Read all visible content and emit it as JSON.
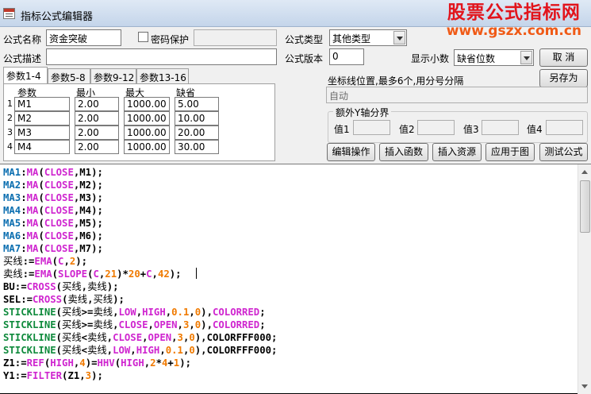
{
  "colors": {
    "keyword": "#0b6eb0",
    "function": "#cf25cf",
    "constant": "#f07a00",
    "text": "#000000",
    "watermark": "#e2141c"
  },
  "title": "指标公式编辑器",
  "watermark": {
    "line1": "股票公式指标网",
    "line2": "www.gszx.com.cn"
  },
  "form": {
    "name_label": "公式名称",
    "name_value": "资金突破",
    "password_label": "密码保护",
    "password_checked": false,
    "type_label": "公式类型",
    "type_value": "其他类型",
    "desc_label": "公式描述",
    "desc_value": "",
    "version_label": "公式版本",
    "version_value": "0",
    "decimal_label": "显示小数",
    "decimal_value": "缺省位数"
  },
  "buttons": {
    "cancel": "取  消",
    "save_as": "另存为",
    "edit_ops": "编辑操作",
    "insert_func": "插入函数",
    "insert_resource": "插入资源",
    "apply_chart": "应用于图",
    "test_formula": "测试公式"
  },
  "tabs": [
    {
      "label": "参数1-4",
      "active": true
    },
    {
      "label": "参数5-8",
      "active": false
    },
    {
      "label": "参数9-12",
      "active": false
    },
    {
      "label": "参数13-16",
      "active": false
    }
  ],
  "params": {
    "headers": [
      "参数",
      "最小",
      "最大",
      "缺省"
    ],
    "rows": [
      {
        "num": "1",
        "name": "M1",
        "min": "2.00",
        "max": "1000.00",
        "default": "5.00"
      },
      {
        "num": "2",
        "name": "M2",
        "min": "2.00",
        "max": "1000.00",
        "default": "10.00"
      },
      {
        "num": "3",
        "name": "M3",
        "min": "2.00",
        "max": "1000.00",
        "default": "20.00"
      },
      {
        "num": "4",
        "name": "M4",
        "min": "2.00",
        "max": "1000.00",
        "default": "30.00"
      }
    ]
  },
  "axis": {
    "label": "坐标线位置,最多6个,用分号分隔",
    "value": "自动",
    "group_title": "额外Y轴分界",
    "values": [
      {
        "label": "值1",
        "value": ""
      },
      {
        "label": "值2",
        "value": ""
      },
      {
        "label": "值3",
        "value": ""
      },
      {
        "label": "值4",
        "value": ""
      }
    ]
  },
  "code_lines": [
    [
      {
        "t": "MA1",
        "c": "k"
      },
      {
        "t": ":",
        "c": "n"
      },
      {
        "t": "MA",
        "c": "f"
      },
      {
        "t": "(",
        "c": "n"
      },
      {
        "t": "CLOSE",
        "c": "f"
      },
      {
        "t": ",M1);",
        "c": "n"
      }
    ],
    [
      {
        "t": "MA2",
        "c": "k"
      },
      {
        "t": ":",
        "c": "n"
      },
      {
        "t": "MA",
        "c": "f"
      },
      {
        "t": "(",
        "c": "n"
      },
      {
        "t": "CLOSE",
        "c": "f"
      },
      {
        "t": ",M2);",
        "c": "n"
      }
    ],
    [
      {
        "t": "MA3",
        "c": "k"
      },
      {
        "t": ":",
        "c": "n"
      },
      {
        "t": "MA",
        "c": "f"
      },
      {
        "t": "(",
        "c": "n"
      },
      {
        "t": "CLOSE",
        "c": "f"
      },
      {
        "t": ",M3);",
        "c": "n"
      }
    ],
    [
      {
        "t": "MA4",
        "c": "k"
      },
      {
        "t": ":",
        "c": "n"
      },
      {
        "t": "MA",
        "c": "f"
      },
      {
        "t": "(",
        "c": "n"
      },
      {
        "t": "CLOSE",
        "c": "f"
      },
      {
        "t": ",M4);",
        "c": "n"
      }
    ],
    [
      {
        "t": "MA5",
        "c": "k"
      },
      {
        "t": ":",
        "c": "n"
      },
      {
        "t": "MA",
        "c": "f"
      },
      {
        "t": "(",
        "c": "n"
      },
      {
        "t": "CLOSE",
        "c": "f"
      },
      {
        "t": ",M5);",
        "c": "n"
      }
    ],
    [
      {
        "t": "MA6",
        "c": "k"
      },
      {
        "t": ":",
        "c": "n"
      },
      {
        "t": "MA",
        "c": "f"
      },
      {
        "t": "(",
        "c": "n"
      },
      {
        "t": "CLOSE",
        "c": "f"
      },
      {
        "t": ",M6);",
        "c": "n"
      }
    ],
    [
      {
        "t": "MA7",
        "c": "k"
      },
      {
        "t": ":",
        "c": "n"
      },
      {
        "t": "MA",
        "c": "f"
      },
      {
        "t": "(",
        "c": "n"
      },
      {
        "t": "CLOSE",
        "c": "f"
      },
      {
        "t": ",M7);",
        "c": "n"
      }
    ],
    [
      {
        "t": "买线",
        "c": "cn"
      },
      {
        "t": ":=",
        "c": "n"
      },
      {
        "t": "EMA",
        "c": "f"
      },
      {
        "t": "(",
        "c": "n"
      },
      {
        "t": "C",
        "c": "f"
      },
      {
        "t": ",",
        "c": "n"
      },
      {
        "t": "2",
        "c": "o"
      },
      {
        "t": ");",
        "c": "n"
      }
    ],
    [
      {
        "t": "卖线",
        "c": "cn"
      },
      {
        "t": ":=",
        "c": "n"
      },
      {
        "t": "EMA",
        "c": "f"
      },
      {
        "t": "(",
        "c": "n"
      },
      {
        "t": "SLOPE",
        "c": "f"
      },
      {
        "t": "(",
        "c": "n"
      },
      {
        "t": "C",
        "c": "f"
      },
      {
        "t": ",",
        "c": "n"
      },
      {
        "t": "21",
        "c": "o"
      },
      {
        "t": ")*",
        "c": "n"
      },
      {
        "t": "20",
        "c": "o"
      },
      {
        "t": "+",
        "c": "n"
      },
      {
        "t": "C",
        "c": "f"
      },
      {
        "t": ",",
        "c": "n"
      },
      {
        "t": "42",
        "c": "o"
      },
      {
        "t": ");",
        "c": "n"
      },
      {
        "t": "",
        "c": "caret"
      }
    ],
    [
      {
        "t": "BU:=",
        "c": "n"
      },
      {
        "t": "CROSS",
        "c": "f"
      },
      {
        "t": "(",
        "c": "n"
      },
      {
        "t": "买线",
        "c": "cn"
      },
      {
        "t": ",",
        "c": "n"
      },
      {
        "t": "卖线",
        "c": "cn"
      },
      {
        "t": ");",
        "c": "n"
      }
    ],
    [
      {
        "t": "SEL:=",
        "c": "n"
      },
      {
        "t": "CROSS",
        "c": "f"
      },
      {
        "t": "(",
        "c": "n"
      },
      {
        "t": "卖线",
        "c": "cn"
      },
      {
        "t": ",",
        "c": "n"
      },
      {
        "t": "买线",
        "c": "cn"
      },
      {
        "t": ");",
        "c": "n"
      }
    ],
    [
      {
        "t": "STICKLINE",
        "c": "g"
      },
      {
        "t": "(",
        "c": "n"
      },
      {
        "t": "买线",
        "c": "cn"
      },
      {
        "t": ">=",
        "c": "n"
      },
      {
        "t": "卖线",
        "c": "cn"
      },
      {
        "t": ",",
        "c": "n"
      },
      {
        "t": "LOW",
        "c": "f"
      },
      {
        "t": ",",
        "c": "n"
      },
      {
        "t": "HIGH",
        "c": "f"
      },
      {
        "t": ",",
        "c": "n"
      },
      {
        "t": "0.1",
        "c": "o"
      },
      {
        "t": ",",
        "c": "n"
      },
      {
        "t": "0",
        "c": "o"
      },
      {
        "t": "),",
        "c": "n"
      },
      {
        "t": "COLORRED",
        "c": "f"
      },
      {
        "t": ";",
        "c": "n"
      }
    ],
    [
      {
        "t": "STICKLINE",
        "c": "g"
      },
      {
        "t": "(",
        "c": "n"
      },
      {
        "t": "买线",
        "c": "cn"
      },
      {
        "t": ">=",
        "c": "n"
      },
      {
        "t": "卖线",
        "c": "cn"
      },
      {
        "t": ",",
        "c": "n"
      },
      {
        "t": "CLOSE",
        "c": "f"
      },
      {
        "t": ",",
        "c": "n"
      },
      {
        "t": "OPEN",
        "c": "f"
      },
      {
        "t": ",",
        "c": "n"
      },
      {
        "t": "3",
        "c": "o"
      },
      {
        "t": ",",
        "c": "n"
      },
      {
        "t": "0",
        "c": "o"
      },
      {
        "t": "),",
        "c": "n"
      },
      {
        "t": "COLORRED",
        "c": "f"
      },
      {
        "t": ";",
        "c": "n"
      }
    ],
    [
      {
        "t": "STICKLINE",
        "c": "g"
      },
      {
        "t": "(",
        "c": "n"
      },
      {
        "t": "买线",
        "c": "cn"
      },
      {
        "t": "<",
        "c": "n"
      },
      {
        "t": "卖线",
        "c": "cn"
      },
      {
        "t": ",",
        "c": "n"
      },
      {
        "t": "CLOSE",
        "c": "f"
      },
      {
        "t": ",",
        "c": "n"
      },
      {
        "t": "OPEN",
        "c": "f"
      },
      {
        "t": ",",
        "c": "n"
      },
      {
        "t": "3",
        "c": "o"
      },
      {
        "t": ",",
        "c": "n"
      },
      {
        "t": "0",
        "c": "o"
      },
      {
        "t": "),COLORFFF000;",
        "c": "n"
      }
    ],
    [
      {
        "t": "STICKLINE",
        "c": "g"
      },
      {
        "t": "(",
        "c": "n"
      },
      {
        "t": "买线",
        "c": "cn"
      },
      {
        "t": "<",
        "c": "n"
      },
      {
        "t": "卖线",
        "c": "cn"
      },
      {
        "t": ",",
        "c": "n"
      },
      {
        "t": "LOW",
        "c": "f"
      },
      {
        "t": ",",
        "c": "n"
      },
      {
        "t": "HIGH",
        "c": "f"
      },
      {
        "t": ",",
        "c": "n"
      },
      {
        "t": "0.1",
        "c": "o"
      },
      {
        "t": ",",
        "c": "n"
      },
      {
        "t": "0",
        "c": "o"
      },
      {
        "t": "),COLORFFF000;",
        "c": "n"
      }
    ],
    [
      {
        "t": "Z1:=",
        "c": "n"
      },
      {
        "t": "REF",
        "c": "f"
      },
      {
        "t": "(",
        "c": "n"
      },
      {
        "t": "HIGH",
        "c": "f"
      },
      {
        "t": ",",
        "c": "n"
      },
      {
        "t": "4",
        "c": "o"
      },
      {
        "t": ")=",
        "c": "n"
      },
      {
        "t": "HHV",
        "c": "f"
      },
      {
        "t": "(",
        "c": "n"
      },
      {
        "t": "HIGH",
        "c": "f"
      },
      {
        "t": ",",
        "c": "n"
      },
      {
        "t": "2",
        "c": "o"
      },
      {
        "t": "*",
        "c": "n"
      },
      {
        "t": "4",
        "c": "o"
      },
      {
        "t": "+",
        "c": "n"
      },
      {
        "t": "1",
        "c": "o"
      },
      {
        "t": ");",
        "c": "n"
      }
    ],
    [
      {
        "t": "Y1:=",
        "c": "n"
      },
      {
        "t": "FILTER",
        "c": "f"
      },
      {
        "t": "(Z1,",
        "c": "n"
      },
      {
        "t": "3",
        "c": "o"
      },
      {
        "t": ");",
        "c": "n"
      }
    ]
  ]
}
